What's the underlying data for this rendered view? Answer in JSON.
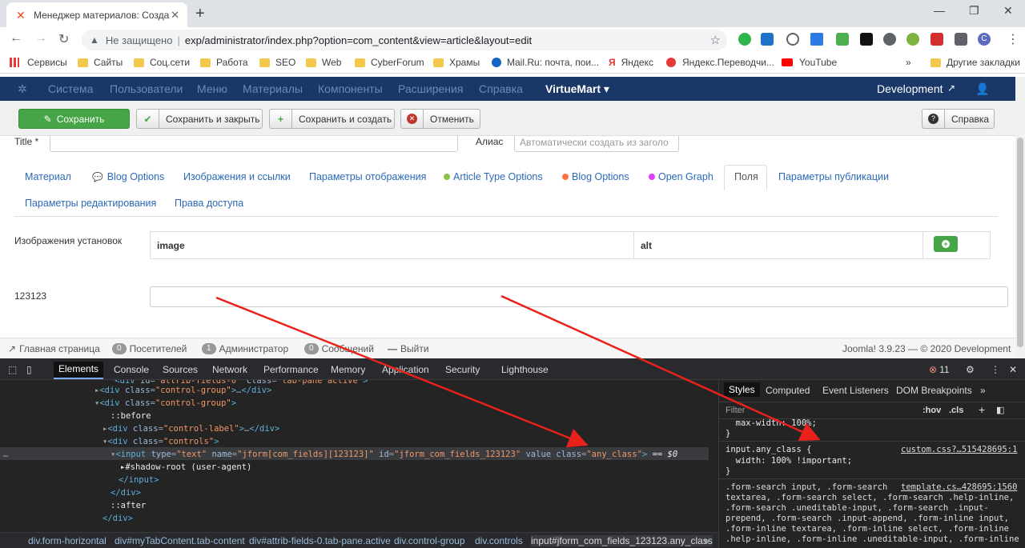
{
  "browser": {
    "tab_title": "Менеджер материалов: Создан",
    "new_tab": "+",
    "url_warning": "Не защищено",
    "url": "exp/administrator/index.php?option=com_content&view=article&layout=edit",
    "bookmarks": [
      "Сервисы",
      "Сайты",
      "Соц.сети",
      "Работа",
      "SEO",
      "Web",
      "CyberForum",
      "Храмы",
      "Mail.Ru: почта, пои...",
      "Яндекс",
      "Яндекс.Переводчи...",
      "YouTube",
      "Другие закладки"
    ],
    "more": "»"
  },
  "joomla": {
    "menu": [
      "Система",
      "Пользователи",
      "Меню",
      "Материалы",
      "Компоненты",
      "Расширения",
      "Справка"
    ],
    "virtuemart": "VirtueMart ▾",
    "site": "Development",
    "toolbar": {
      "save": "Сохранить",
      "save_close": "Сохранить и закрыть",
      "save_new": "Сохранить и создать",
      "cancel": "Отменить",
      "help": "Справка"
    },
    "title_label": "Title *",
    "alias_label": "Алиас",
    "alias_placeholder": "Автоматически создать из заголо",
    "tabs": [
      "Материал",
      "Blog Options",
      "Изображения и ссылки",
      "Параметры отображения",
      "Article Type Options",
      "Blog Options",
      "Open Graph",
      "Поля",
      "Параметры публикации",
      "Параметры редактирования",
      "Права доступа"
    ],
    "images_label": "Изображения установок",
    "col_image": "image",
    "col_alt": "alt",
    "field_label": "123123",
    "status": {
      "home": "Главная страница",
      "visitors_count": "0",
      "visitors": "Посетителей",
      "admins_count": "1",
      "admins": "Администратор",
      "messages_count": "0",
      "messages": "Сообщений",
      "logout": "Выйти",
      "version": "Joomla! 3.9.23 — © 2020 Development"
    }
  },
  "devtools": {
    "tabs": [
      "Elements",
      "Console",
      "Sources",
      "Network",
      "Performance",
      "Memory",
      "Application",
      "Security",
      "Lighthouse"
    ],
    "error_count": "11",
    "styles_tabs": [
      "Styles",
      "Computed",
      "Event Listeners",
      "DOM Breakpoints",
      "»"
    ],
    "filter": "Filter",
    "hov": ":hov",
    "cls": ".cls",
    "css1_prop": "  max-width: 100%;",
    "css1_close": "}",
    "css2_selector": "input.any_class {",
    "css2_source": "custom.css?…515428695:1",
    "css2_prop": "  width: 100% !important;",
    "css2_close": "}",
    "css3_source": "template.cs…428695:1560",
    "css3_lines": [
      ".form-search input, .form-search",
      "textarea, .form-search select, .form-search .help-inline,",
      ".form-search .uneditable-input, .form-search .input-",
      "prepend, .form-search .input-append, .form-inline input,",
      ".form-inline textarea, .form-inline select, .form-inline",
      ".help-inline, .form-inline .uneditable-input, .form-inline"
    ],
    "breadcrumbs": [
      "div.form-horizontal",
      "div#myTabContent.tab-content",
      "div#attrib-fields-0.tab-pane.active",
      "div.control-group",
      "div.controls",
      "input#jform_com_fields_123123.any_class"
    ]
  }
}
